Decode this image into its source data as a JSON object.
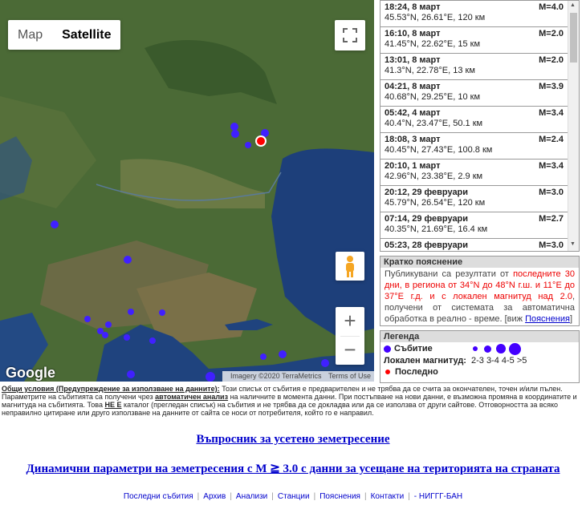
{
  "map": {
    "type_map": "Map",
    "type_satellite": "Satellite",
    "google": "Google",
    "imagery": "Imagery ©2020 TerraMetrics",
    "terms": "Terms of Use",
    "zoom_in": "+",
    "zoom_out": "−",
    "colors": {
      "land": "#3d5f2e",
      "sea": "#1d3f7a",
      "marker": "#4020ff",
      "recent": "#ff0000"
    }
  },
  "events": [
    {
      "time": "18:24, 8 март",
      "mag": "M=4.0",
      "loc": "45.53°N, 26.61°E, 120 км"
    },
    {
      "time": "16:10, 8 март",
      "mag": "M=2.0",
      "loc": "41.45°N, 22.62°E, 15 км"
    },
    {
      "time": "13:01, 8 март",
      "mag": "M=2.0",
      "loc": "41.3°N, 22.78°E, 13 км"
    },
    {
      "time": "04:21, 8 март",
      "mag": "M=3.9",
      "loc": "40.68°N, 29.25°E, 10 км"
    },
    {
      "time": "05:42, 4 март",
      "mag": "M=3.4",
      "loc": "40.4°N, 23.47°E, 50.1 км"
    },
    {
      "time": "18:08, 3 март",
      "mag": "M=2.4",
      "loc": "40.45°N, 27.43°E, 100.8 км"
    },
    {
      "time": "20:10, 1 март",
      "mag": "M=3.4",
      "loc": "42.96°N, 23.38°E, 2.9 км"
    },
    {
      "time": "20:12, 29 февруари",
      "mag": "M=3.0",
      "loc": "45.79°N, 26.54°E, 120 км"
    },
    {
      "time": "07:14, 29 февруари",
      "mag": "M=2.7",
      "loc": "40.35°N, 21.69°E, 16.4 км"
    },
    {
      "time": "05:23, 28 февруари",
      "mag": "M=3.0",
      "loc": ""
    }
  ],
  "explain": {
    "title": "Кратко пояснение",
    "p1": "Публикувани са резултати от ",
    "p2": "последните 30 дни, в региона от 34°N до 48°N г.ш. и 11°E до 37°E г.д. и с локален магнитуд над 2.0",
    "p3": ", получени от системата за автоматична обработка в реално - време. [виж ",
    "link": "Пояснения",
    "p4": "]"
  },
  "legend": {
    "title": "Легенда",
    "event": "Събитие",
    "magnitude": "Локален магнитуд:",
    "mag_classes": "2-3 3-4 4-5 >5",
    "latest": "Последно"
  },
  "terms": {
    "t1": "Общи условия (Предупреждение за използване на данните):",
    "t2": " Този списък от събития е предварителен и не трябва да се счита за окончателен, точен и/или пълен. Параметрите на събитията са получени чрез ",
    "t3": "автоматичен анализ",
    "t4": " на наличните в момента данни. При постъпване на нови данни, е възможна промяна в координатите и магнитуда на събитията. Това ",
    "t5": "НЕ Е",
    "t6": " каталог (прегледан списък) на събития и не трябва да се докладва или да се използва от други сайтове. Отговорността за всяко неправилно цитиране или друго използване на данните от сайта се носи от потребителя, който го е направил."
  },
  "links": {
    "felt": "Въпросник за усетено земетресение",
    "dynamic": "Динамични параметри на земетресения с M ≧ 3.0 с данни за усещане на територията на страната"
  },
  "footer": [
    "Последни събития",
    "Архив",
    "Анализи",
    "Станции",
    "Пояснения",
    "Контакти",
    "- НИГГГ-БАН"
  ]
}
